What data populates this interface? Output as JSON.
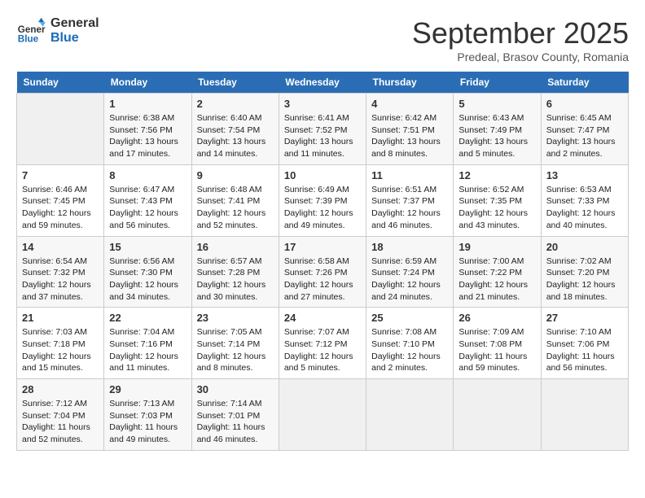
{
  "logo": {
    "line1": "General",
    "line2": "Blue"
  },
  "title": "September 2025",
  "subtitle": "Predeal, Brasov County, Romania",
  "weekdays": [
    "Sunday",
    "Monday",
    "Tuesday",
    "Wednesday",
    "Thursday",
    "Friday",
    "Saturday"
  ],
  "weeks": [
    [
      {
        "day": "",
        "info": ""
      },
      {
        "day": "1",
        "info": "Sunrise: 6:38 AM\nSunset: 7:56 PM\nDaylight: 13 hours\nand 17 minutes."
      },
      {
        "day": "2",
        "info": "Sunrise: 6:40 AM\nSunset: 7:54 PM\nDaylight: 13 hours\nand 14 minutes."
      },
      {
        "day": "3",
        "info": "Sunrise: 6:41 AM\nSunset: 7:52 PM\nDaylight: 13 hours\nand 11 minutes."
      },
      {
        "day": "4",
        "info": "Sunrise: 6:42 AM\nSunset: 7:51 PM\nDaylight: 13 hours\nand 8 minutes."
      },
      {
        "day": "5",
        "info": "Sunrise: 6:43 AM\nSunset: 7:49 PM\nDaylight: 13 hours\nand 5 minutes."
      },
      {
        "day": "6",
        "info": "Sunrise: 6:45 AM\nSunset: 7:47 PM\nDaylight: 13 hours\nand 2 minutes."
      }
    ],
    [
      {
        "day": "7",
        "info": "Sunrise: 6:46 AM\nSunset: 7:45 PM\nDaylight: 12 hours\nand 59 minutes."
      },
      {
        "day": "8",
        "info": "Sunrise: 6:47 AM\nSunset: 7:43 PM\nDaylight: 12 hours\nand 56 minutes."
      },
      {
        "day": "9",
        "info": "Sunrise: 6:48 AM\nSunset: 7:41 PM\nDaylight: 12 hours\nand 52 minutes."
      },
      {
        "day": "10",
        "info": "Sunrise: 6:49 AM\nSunset: 7:39 PM\nDaylight: 12 hours\nand 49 minutes."
      },
      {
        "day": "11",
        "info": "Sunrise: 6:51 AM\nSunset: 7:37 PM\nDaylight: 12 hours\nand 46 minutes."
      },
      {
        "day": "12",
        "info": "Sunrise: 6:52 AM\nSunset: 7:35 PM\nDaylight: 12 hours\nand 43 minutes."
      },
      {
        "day": "13",
        "info": "Sunrise: 6:53 AM\nSunset: 7:33 PM\nDaylight: 12 hours\nand 40 minutes."
      }
    ],
    [
      {
        "day": "14",
        "info": "Sunrise: 6:54 AM\nSunset: 7:32 PM\nDaylight: 12 hours\nand 37 minutes."
      },
      {
        "day": "15",
        "info": "Sunrise: 6:56 AM\nSunset: 7:30 PM\nDaylight: 12 hours\nand 34 minutes."
      },
      {
        "day": "16",
        "info": "Sunrise: 6:57 AM\nSunset: 7:28 PM\nDaylight: 12 hours\nand 30 minutes."
      },
      {
        "day": "17",
        "info": "Sunrise: 6:58 AM\nSunset: 7:26 PM\nDaylight: 12 hours\nand 27 minutes."
      },
      {
        "day": "18",
        "info": "Sunrise: 6:59 AM\nSunset: 7:24 PM\nDaylight: 12 hours\nand 24 minutes."
      },
      {
        "day": "19",
        "info": "Sunrise: 7:00 AM\nSunset: 7:22 PM\nDaylight: 12 hours\nand 21 minutes."
      },
      {
        "day": "20",
        "info": "Sunrise: 7:02 AM\nSunset: 7:20 PM\nDaylight: 12 hours\nand 18 minutes."
      }
    ],
    [
      {
        "day": "21",
        "info": "Sunrise: 7:03 AM\nSunset: 7:18 PM\nDaylight: 12 hours\nand 15 minutes."
      },
      {
        "day": "22",
        "info": "Sunrise: 7:04 AM\nSunset: 7:16 PM\nDaylight: 12 hours\nand 11 minutes."
      },
      {
        "day": "23",
        "info": "Sunrise: 7:05 AM\nSunset: 7:14 PM\nDaylight: 12 hours\nand 8 minutes."
      },
      {
        "day": "24",
        "info": "Sunrise: 7:07 AM\nSunset: 7:12 PM\nDaylight: 12 hours\nand 5 minutes."
      },
      {
        "day": "25",
        "info": "Sunrise: 7:08 AM\nSunset: 7:10 PM\nDaylight: 12 hours\nand 2 minutes."
      },
      {
        "day": "26",
        "info": "Sunrise: 7:09 AM\nSunset: 7:08 PM\nDaylight: 11 hours\nand 59 minutes."
      },
      {
        "day": "27",
        "info": "Sunrise: 7:10 AM\nSunset: 7:06 PM\nDaylight: 11 hours\nand 56 minutes."
      }
    ],
    [
      {
        "day": "28",
        "info": "Sunrise: 7:12 AM\nSunset: 7:04 PM\nDaylight: 11 hours\nand 52 minutes."
      },
      {
        "day": "29",
        "info": "Sunrise: 7:13 AM\nSunset: 7:03 PM\nDaylight: 11 hours\nand 49 minutes."
      },
      {
        "day": "30",
        "info": "Sunrise: 7:14 AM\nSunset: 7:01 PM\nDaylight: 11 hours\nand 46 minutes."
      },
      {
        "day": "",
        "info": ""
      },
      {
        "day": "",
        "info": ""
      },
      {
        "day": "",
        "info": ""
      },
      {
        "day": "",
        "info": ""
      }
    ]
  ]
}
